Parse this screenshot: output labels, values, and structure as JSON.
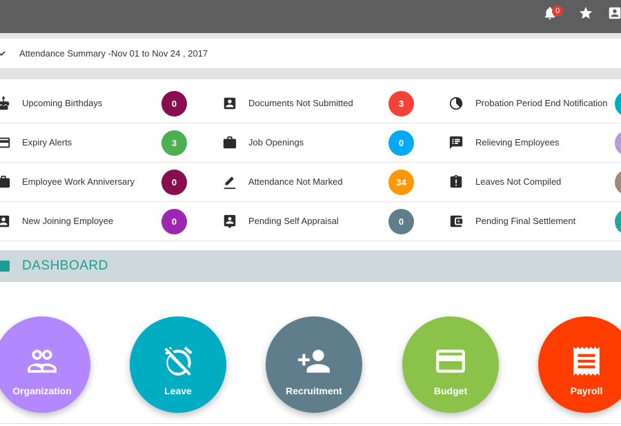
{
  "topbar": {
    "notification_count": "0",
    "icons": [
      "bell-icon",
      "star-icon",
      "account-box-icon"
    ]
  },
  "summary": {
    "title": "Attendance Summary -Nov 01 to Nov 24 , 2017"
  },
  "widgets": [
    {
      "label": "Upcoming Birthdays",
      "count": "0",
      "color": "#880e4f",
      "icon": "cake-icon"
    },
    {
      "label": "Documents Not Submitted",
      "count": "3",
      "color": "#f44336",
      "icon": "contact-card-icon"
    },
    {
      "label": "Probation Period End Notification",
      "count": "",
      "color": "#00acc1",
      "icon": "pie-clock-icon"
    },
    {
      "label": "Expiry Alerts",
      "count": "3",
      "color": "#4caf50",
      "icon": "credit-card-icon"
    },
    {
      "label": "Job Openings",
      "count": "0",
      "color": "#03a9f4",
      "icon": "briefcase-icon"
    },
    {
      "label": "Relieving Employees",
      "count": "",
      "color": "#b39ddb",
      "icon": "comment-list-icon"
    },
    {
      "label": "Employee Work Anniversary",
      "count": "0",
      "color": "#880e4f",
      "icon": "briefcase-icon"
    },
    {
      "label": "Attendance Not Marked",
      "count": "34",
      "color": "#ff9800",
      "icon": "pencil-icon"
    },
    {
      "label": "Leaves Not Compiled",
      "count": "",
      "color": "#a1887f",
      "icon": "alert-clipboard-icon"
    },
    {
      "label": "New Joining Employee",
      "count": "0",
      "color": "#9c27b0",
      "icon": "person-badge-icon"
    },
    {
      "label": "Pending Self Appraisal",
      "count": "0",
      "color": "#607d8b",
      "icon": "person-comment-icon"
    },
    {
      "label": "Pending Final Settlement",
      "count": "",
      "color": "#26a69a",
      "icon": "wallet-icon"
    }
  ],
  "dashboard": {
    "title": "DASHBOARD",
    "tiles": [
      {
        "label": "Organization",
        "color": "#b388ff",
        "icon": "people-icon"
      },
      {
        "label": "Leave",
        "color": "#00acc1",
        "icon": "alarm-off-icon"
      },
      {
        "label": "Recruitment",
        "color": "#607d8b",
        "icon": "add-person-icon"
      },
      {
        "label": "Budget",
        "color": "#8bc34a",
        "icon": "credit-card-icon"
      },
      {
        "label": "Payroll",
        "color": "#ff3d00",
        "icon": "receipt-icon"
      }
    ]
  }
}
